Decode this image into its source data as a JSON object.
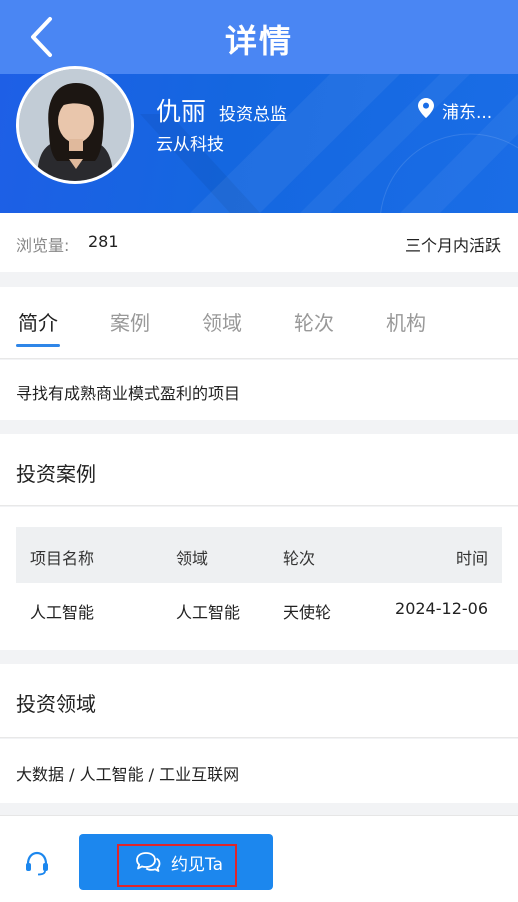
{
  "header": {
    "title": "详情"
  },
  "profile": {
    "name": "仇丽",
    "role": "投资总监",
    "company": "云从科技",
    "location": "浦东..."
  },
  "stats": {
    "views_label": "浏览量:",
    "views_value": "281",
    "activity": "三个月内活跃"
  },
  "tabs": [
    {
      "label": "简介",
      "active": true
    },
    {
      "label": "案例",
      "active": false
    },
    {
      "label": "领域",
      "active": false
    },
    {
      "label": "轮次",
      "active": false
    },
    {
      "label": "机构",
      "active": false
    }
  ],
  "intro": {
    "text": "寻找有成熟商业模式盈利的项目"
  },
  "cases": {
    "title": "投资案例",
    "columns": [
      "项目名称",
      "领域",
      "轮次",
      "时间"
    ],
    "rows": [
      [
        "人工智能",
        "人工智能",
        "天使轮",
        "2024-12-06"
      ]
    ]
  },
  "domains": {
    "title": "投资领域",
    "text": "大数据 / 人工智能 / 工业互联网"
  },
  "bottom": {
    "meet_label": "约见Ta"
  },
  "colors": {
    "nav": "#4a86f3",
    "hero": "#1467e0",
    "accent": "#1c87ee",
    "highlight": "#e0262a"
  },
  "icons": {
    "back": "chevron-left-icon",
    "location": "location-pin-icon",
    "service": "headset-icon",
    "chat": "chat-bubbles-icon"
  }
}
